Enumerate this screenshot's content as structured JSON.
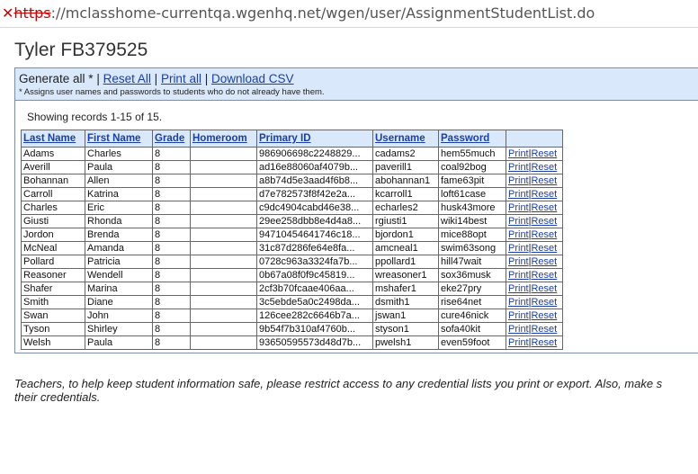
{
  "browser": {
    "url_scheme": "https",
    "url_rest": "://mclasshome-currentqa.wgenhq.net/wgen/user/AssignmentStudentList.do"
  },
  "page_title": "Tyler FB379525",
  "actions": {
    "generate_all": "Generate all *",
    "reset_all": "Reset All",
    "print_all": "Print all",
    "download_csv": "Download CSV",
    "note": "* Assigns user names and passwords to students who do not already have them."
  },
  "records_text": "Showing records 1-15 of 15.",
  "table": {
    "headers": [
      "Last Name",
      "First Name",
      "Grade",
      "Homeroom",
      "Primary ID",
      "Username",
      "Password"
    ],
    "print_label": "Print",
    "reset_label": "Reset",
    "rows": [
      [
        "Adams",
        "Charles",
        "8",
        "",
        "986906698c2248829...",
        "cadams2",
        "hem55much"
      ],
      [
        "Averill",
        "Paula",
        "8",
        "",
        "ad16e88060af4079b...",
        "paverill1",
        "coal92bog"
      ],
      [
        "Bohannan",
        "Allen",
        "8",
        "",
        "a8b74d5e3aad4f6b8...",
        "abohannan1",
        "fame63pit"
      ],
      [
        "Carroll",
        "Katrina",
        "8",
        "",
        "d7e782573f8f42e2a...",
        "kcarroll1",
        "loft61case"
      ],
      [
        "Charles",
        "Eric",
        "8",
        "",
        "c9dc4904cabd46e38...",
        "echarles2",
        "husk43more"
      ],
      [
        "Giusti",
        "Rhonda",
        "8",
        "",
        "29ee258dbb8e4d4a8...",
        "rgiusti1",
        "wiki14best"
      ],
      [
        "Jordon",
        "Brenda",
        "8",
        "",
        "94710454641746c18...",
        "bjordon1",
        "mice88opt"
      ],
      [
        "McNeal",
        "Amanda",
        "8",
        "",
        "31c87d286fe64e8fa...",
        "amcneal1",
        "swim63song"
      ],
      [
        "Pollard",
        "Patricia",
        "8",
        "",
        "0728c963a3324fa7b...",
        "ppollard1",
        "hill47wait"
      ],
      [
        "Reasoner",
        "Wendell",
        "8",
        "",
        "0b67a08f0f9c45819...",
        "wreasoner1",
        "sox36musk"
      ],
      [
        "Shafer",
        "Marina",
        "8",
        "",
        "2cf3b70fcaae406aa...",
        "mshafer1",
        "eke27pry"
      ],
      [
        "Smith",
        "Diane",
        "8",
        "",
        "3c5ebde5a0c2498da...",
        "dsmith1",
        "rise64net"
      ],
      [
        "Swan",
        "John",
        "8",
        "",
        "126cee282c6646b7a...",
        "jswan1",
        "cure46nick"
      ],
      [
        "Tyson",
        "Shirley",
        "8",
        "",
        "9b54f7b310af4760b...",
        "styson1",
        "sofa40kit"
      ],
      [
        "Welsh",
        "Paula",
        "8",
        "",
        "93650595573d48d7b...",
        "pwelsh1",
        "even59foot"
      ]
    ]
  },
  "footer_text_line1": "Teachers, to help keep student information safe, please restrict access to any credential lists you print or export. Also, make s",
  "footer_text_line2": "their credentials."
}
